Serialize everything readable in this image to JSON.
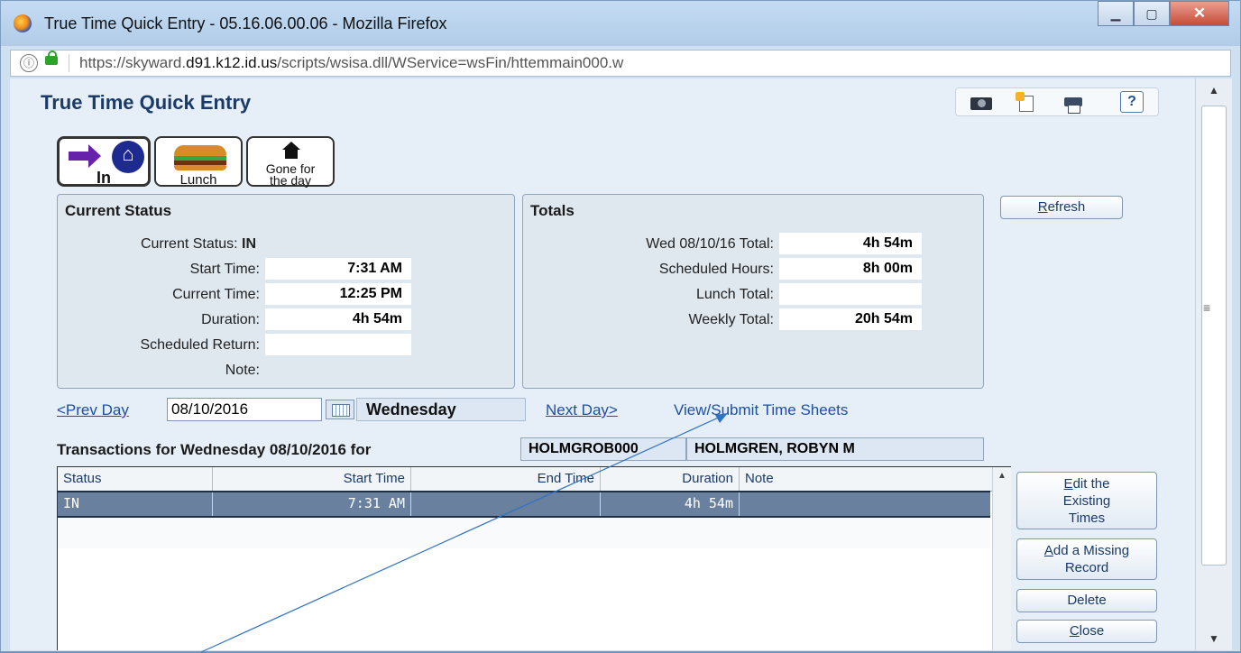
{
  "window": {
    "title": "True Time Quick Entry - 05.16.06.00.06 - Mozilla Firefox",
    "url_prefix": "https://skyward.",
    "url_domain": "d91.k12.id.us",
    "url_path": "/scripts/wsisa.dll/WService=wsFin/httemmain000.w",
    "info_glyph": "ⓘ",
    "minimize_glyph": "▁",
    "maximize_glyph": "▢",
    "close_glyph": "✕"
  },
  "page": {
    "title": "True Time Quick Entry",
    "help_label": "?"
  },
  "punch_buttons": {
    "in_label": "In",
    "lunch_label": "Lunch",
    "gone_label_line1": "Gone for",
    "gone_label_line2": "the day"
  },
  "current_status": {
    "title": "Current Status",
    "status_label": "Current Status:",
    "status_value": "IN",
    "start_label": "Start Time:",
    "start_value": "7:31 AM",
    "current_time_label": "Current Time:",
    "current_time_value": "12:25 PM",
    "duration_label": "Duration:",
    "duration_value": "4h 54m",
    "scheduled_return_label": "Scheduled Return:",
    "scheduled_return_value": "",
    "note_label": "Note:",
    "note_value": ""
  },
  "totals": {
    "title": "Totals",
    "day_total_label": "Wed 08/10/16 Total:",
    "day_total_value": "4h 54m",
    "scheduled_hours_label": "Scheduled Hours:",
    "scheduled_hours_value": "8h 00m",
    "lunch_total_label": "Lunch Total:",
    "lunch_total_value": "",
    "weekly_total_label": "Weekly Total:",
    "weekly_total_value": "20h 54m"
  },
  "refresh": {
    "accel": "R",
    "rest": "efresh"
  },
  "nav": {
    "prev_day": "<Prev Day",
    "date_value": "08/10/2016",
    "day_name": "Wednesday",
    "next_day": "Next Day>",
    "view_submit": "View/Submit Time Sheets"
  },
  "transactions": {
    "title": "Transactions for Wednesday 08/10/2016 for",
    "employee_id": "HOLMGROB000",
    "employee_name": "HOLMGREN, ROBYN M",
    "columns": {
      "status": "Status",
      "start_time": "Start Time",
      "end_time": "End Time",
      "duration": "Duration",
      "note": "Note"
    },
    "rows": [
      {
        "status": "IN",
        "start_time": "7:31 AM",
        "end_time": "",
        "duration": "4h 54m",
        "note": ""
      }
    ]
  },
  "side_buttons": {
    "edit_accel": "E",
    "edit_rest_line1": "dit the",
    "edit_line2": "Existing",
    "edit_line3": "Times",
    "add_accel": "A",
    "add_rest_line1": "dd a Missing",
    "add_line2": "Record",
    "delete": "Delete",
    "close_accel": "C",
    "close_rest": "lose"
  },
  "scrollbar": {
    "up_glyph": "▲",
    "down_glyph": "▼",
    "grip_glyph": "≡"
  }
}
